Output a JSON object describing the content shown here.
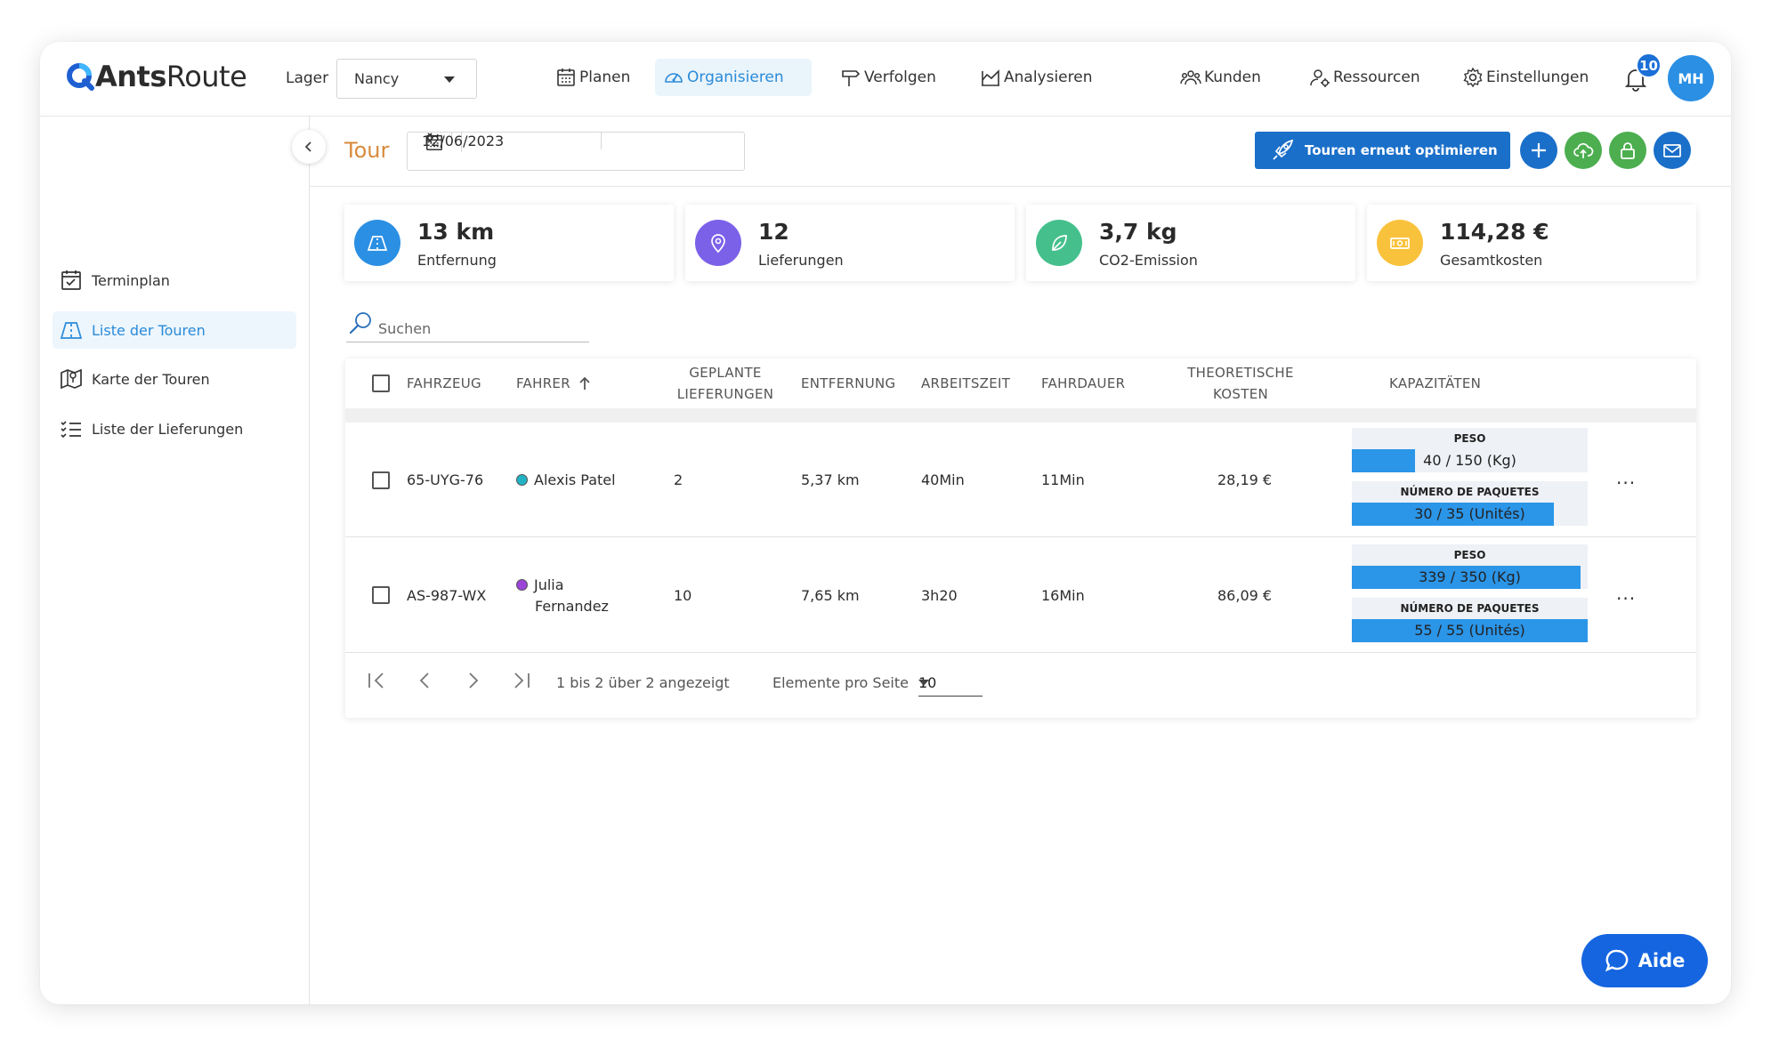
{
  "app": {
    "logo_text_bold": "Ants",
    "logo_text": "Route"
  },
  "header": {
    "warehouse_label": "Lager",
    "warehouse_value": "Nancy",
    "nav": [
      {
        "label": "Planen",
        "icon": "calendar-icon"
      },
      {
        "label": "Organisieren",
        "icon": "speedometer-icon",
        "active": true
      },
      {
        "label": "Verfolgen",
        "icon": "signpost-icon"
      },
      {
        "label": "Analysieren",
        "icon": "chart-icon"
      },
      {
        "label": "Kunden",
        "icon": "group-icon"
      },
      {
        "label": "Ressourcen",
        "icon": "user-gear-icon"
      },
      {
        "label": "Einstellungen",
        "icon": "gear-icon"
      }
    ],
    "notification_count": "10",
    "avatar_initials": "MH"
  },
  "sidebar": {
    "items": [
      {
        "label": "Terminplan",
        "icon": "calendar-check-icon"
      },
      {
        "label": "Liste der Touren",
        "icon": "road-icon",
        "active": true
      },
      {
        "label": "Karte der Touren",
        "icon": "map-pin-icon"
      },
      {
        "label": "Liste der Lieferungen",
        "icon": "checklist-icon"
      }
    ]
  },
  "toolbar": {
    "title": "Tour",
    "date": "12/06/2023",
    "optimize_label": "Touren erneut optimieren",
    "colors": {
      "primary": "#1a6fc9",
      "green": "#4cae4f"
    }
  },
  "stats": [
    {
      "value": "13 km",
      "label": "Entfernung",
      "color": "#2b8fe3",
      "icon": "road-icon"
    },
    {
      "value": "12",
      "label": "Lieferungen",
      "color": "#7b61e8",
      "icon": "pin-icon"
    },
    {
      "value": "3,7 kg",
      "label": "CO2-Emission",
      "color": "#45c08c",
      "icon": "leaf-icon"
    },
    {
      "value": "114,28 €",
      "label": "Gesamtkosten",
      "color": "#f9c23c",
      "icon": "money-icon"
    }
  ],
  "search": {
    "placeholder": "Suchen"
  },
  "table": {
    "headers": {
      "vehicle": "FAHRZEUG",
      "driver": "FAHRER",
      "planned_1": "GEPLANTE",
      "planned_2": "LIEFERUNGEN",
      "distance": "ENTFERNUNG",
      "worktime": "ARBEITSZEIT",
      "drivetime": "FAHRDAUER",
      "cost_1": "THEORETISCHE",
      "cost_2": "KOSTEN",
      "capacity": "KAPAZITÄTEN"
    },
    "rows": [
      {
        "vehicle": "65-UYG-76",
        "driver_line1": "Alexis Patel",
        "driver_line2": "",
        "driver_color": "#21b3c4",
        "planned": "2",
        "distance": "5,37 km",
        "worktime": "40Min",
        "drivetime": "11Min",
        "cost": "28,19 €",
        "cap_weight_label": "PESO",
        "cap_weight_text": "40 / 150 (Kg)",
        "cap_weight_fraction": 0.267,
        "cap_packages_label": "NÚMERO DE PAQUETES",
        "cap_packages_text": "30 / 35 (Unités)",
        "cap_packages_fraction": 0.857,
        "more": "..."
      },
      {
        "vehicle": "AS-987-WX",
        "driver_line1": "Julia",
        "driver_line2": "Fernandez",
        "driver_color": "#9b45d8",
        "planned": "10",
        "distance": "7,65 km",
        "worktime": "3h20",
        "drivetime": "16Min",
        "cost": "86,09 €",
        "cap_weight_label": "PESO",
        "cap_weight_text": "339 / 350 (Kg)",
        "cap_weight_fraction": 0.969,
        "cap_packages_label": "NÚMERO DE PAQUETES",
        "cap_packages_text": "55 / 55 (Unités)",
        "cap_packages_fraction": 1.0,
        "more": "..."
      }
    ],
    "pagination": {
      "range_text": "1 bis 2 über 2 angezeigt",
      "per_page_label": "Elemente pro Seite",
      "per_page_value": "10"
    }
  },
  "help": {
    "label": "Aide"
  }
}
